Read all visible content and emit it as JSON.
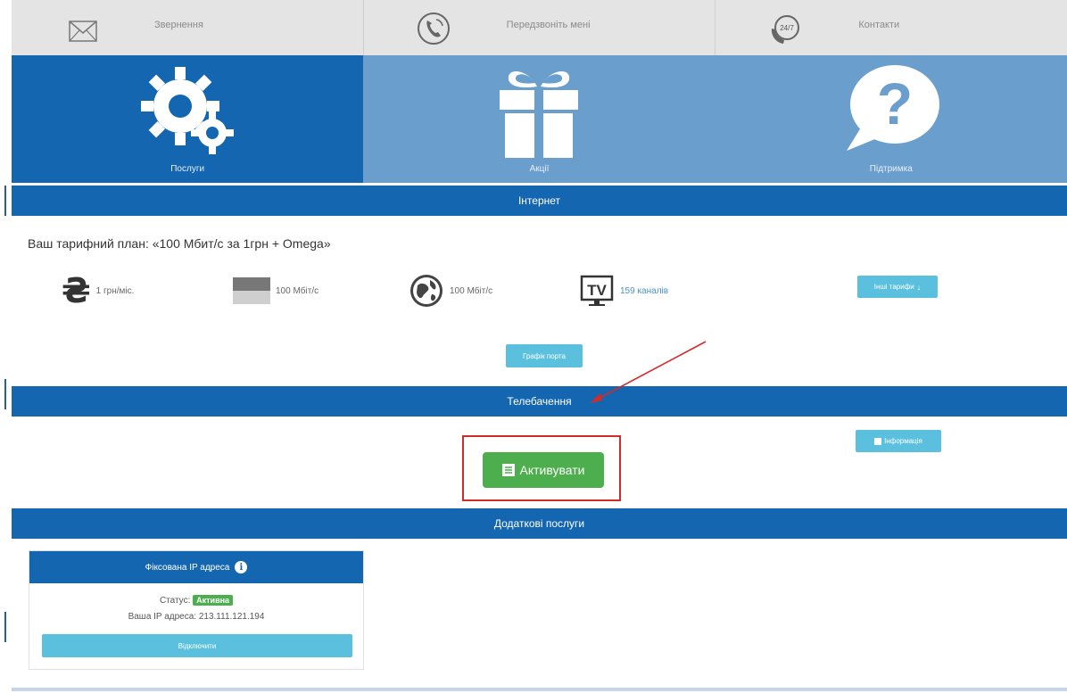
{
  "top_nav": [
    {
      "label": "Звернення",
      "icon": "envelope-icon"
    },
    {
      "label": "Передзвоніть мені",
      "icon": "phone-callback-icon"
    },
    {
      "label": "Контакти",
      "icon": "phone-24-7-icon"
    }
  ],
  "tiles": [
    {
      "label": "Послуги",
      "icon": "gears-icon",
      "active": true
    },
    {
      "label": "Акції",
      "icon": "gift-icon",
      "active": false
    },
    {
      "label": "Підтримка",
      "icon": "question-bubble-icon",
      "active": false
    }
  ],
  "internet": {
    "header": "Інтернет",
    "plan": "Ваш тарифний план: «100 Мбит/с за 1грн + Omega»",
    "price": "1 грн/міс.",
    "speed_local": "100 Мбіт/с",
    "speed_world": "100 Мбіт/с",
    "tv_channels": "159 каналів",
    "other_tariffs_button": "Інші тарифи",
    "port_graph_button": "Графік порта",
    "tv_icon_text": "TV"
  },
  "tv": {
    "header": "Телебачення",
    "activate_button": "Активувати",
    "info_button": "Інформація"
  },
  "extras": {
    "header": "Додаткові послуги",
    "ip_card": {
      "title": "Фіксована IP адреса",
      "status_label": "Статус:",
      "status_value": "Активна",
      "ip_label": "Ваша IP адреса:",
      "ip_value": "213.111.121.194",
      "disconnect_button": "Відключити"
    }
  },
  "colors": {
    "primary": "#1566b0",
    "tile_inactive": "#6a9ecd",
    "info_button": "#5bc0de",
    "success": "#4cae4c",
    "annotation": "#d42a2a"
  }
}
